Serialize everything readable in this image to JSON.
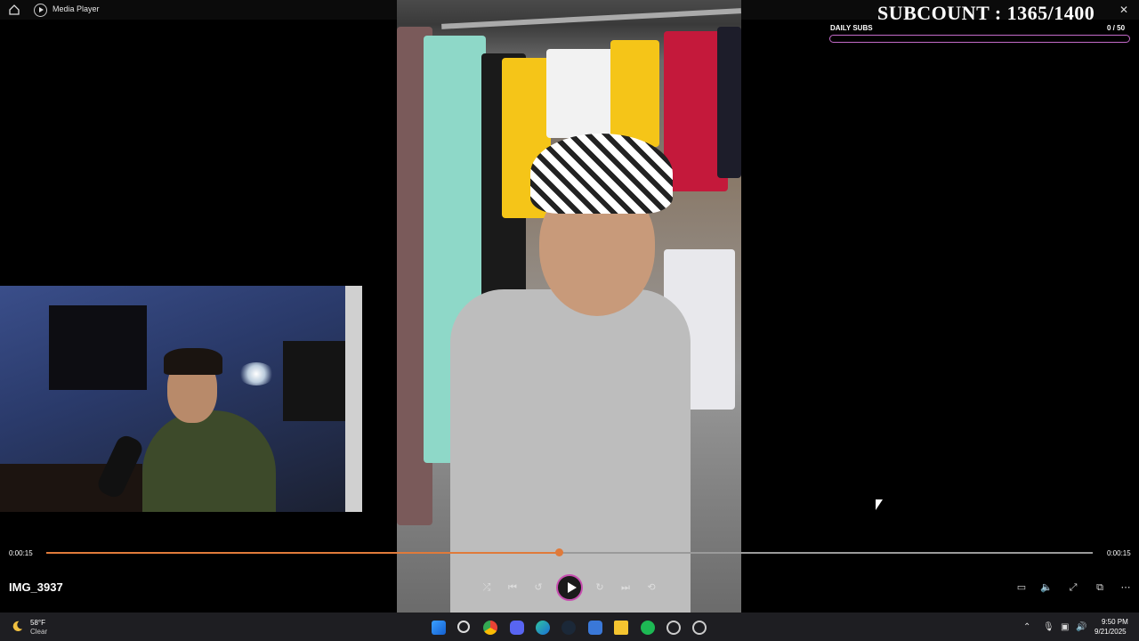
{
  "window": {
    "title": "Media Player"
  },
  "overlay": {
    "subcount": "SUBCOUNT : 1365/1400",
    "daily_label": "DAILY SUBS",
    "daily_count": "0   / 50",
    "daily_progress": 0,
    "bar_color": "#c46bc9"
  },
  "player": {
    "filename": "IMG_3937",
    "time_current": "0:00:15",
    "time_total": "0:00:15",
    "progress_fraction": 0.49,
    "accent": "#e07a3a"
  },
  "controls": [
    "shuffle-icon",
    "previous-icon",
    "rewind-10-icon",
    "play-icon",
    "forward-30-icon",
    "next-icon",
    "repeat-off-icon"
  ],
  "right_controls": [
    "miniplayer-icon",
    "volume-icon",
    "fullscreen-icon",
    "cast-icon",
    "more-icon"
  ],
  "taskbar": {
    "weather_temp": "58°F",
    "weather_desc": "Clear",
    "time": "9:50 PM",
    "date": "9/21/2025",
    "apps": [
      "windows-start-icon",
      "search-icon",
      "chrome-icon",
      "discord-icon",
      "edge-icon",
      "steam-icon",
      "app-icon",
      "file-explorer-icon",
      "spotify-icon",
      "app-icon-2",
      "media-player-icon"
    ]
  }
}
